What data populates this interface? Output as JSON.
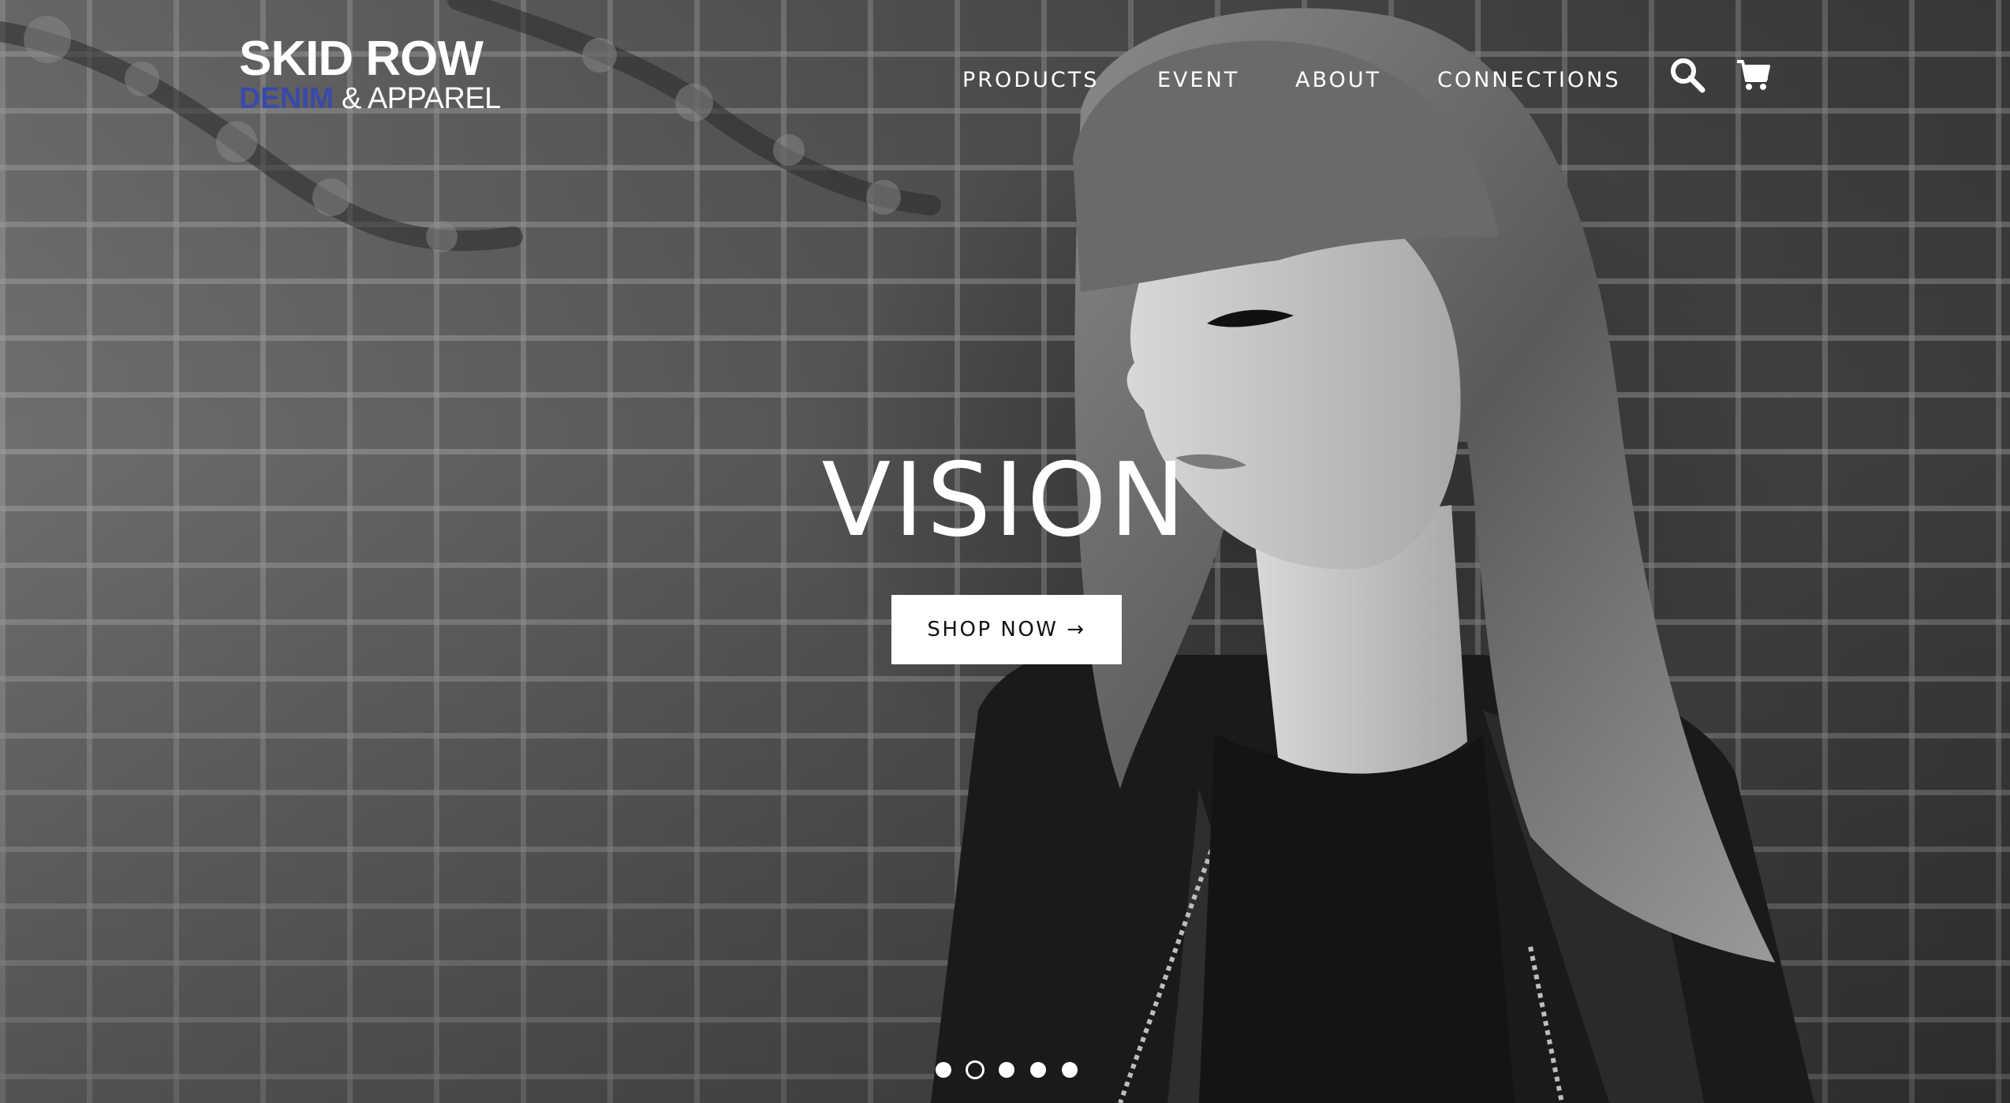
{
  "header": {
    "logo": {
      "line1": "SKID ROW",
      "line2_part1": "DENIM",
      "line2_part2": " & APPAREL"
    },
    "nav": [
      {
        "label": "PRODUCTS"
      },
      {
        "label": "EVENT"
      },
      {
        "label": "ABOUT"
      },
      {
        "label": "CONNECTIONS"
      }
    ],
    "icons": {
      "search": "search-icon",
      "cart": "cart-icon"
    }
  },
  "hero": {
    "title": "VISION",
    "button_label": "SHOP NOW →",
    "slides_total": 5,
    "active_slide": 2
  },
  "colors": {
    "logo_accent": "#3b4aa8",
    "text": "#ffffff",
    "button_bg": "#ffffff",
    "button_text": "#111111"
  }
}
